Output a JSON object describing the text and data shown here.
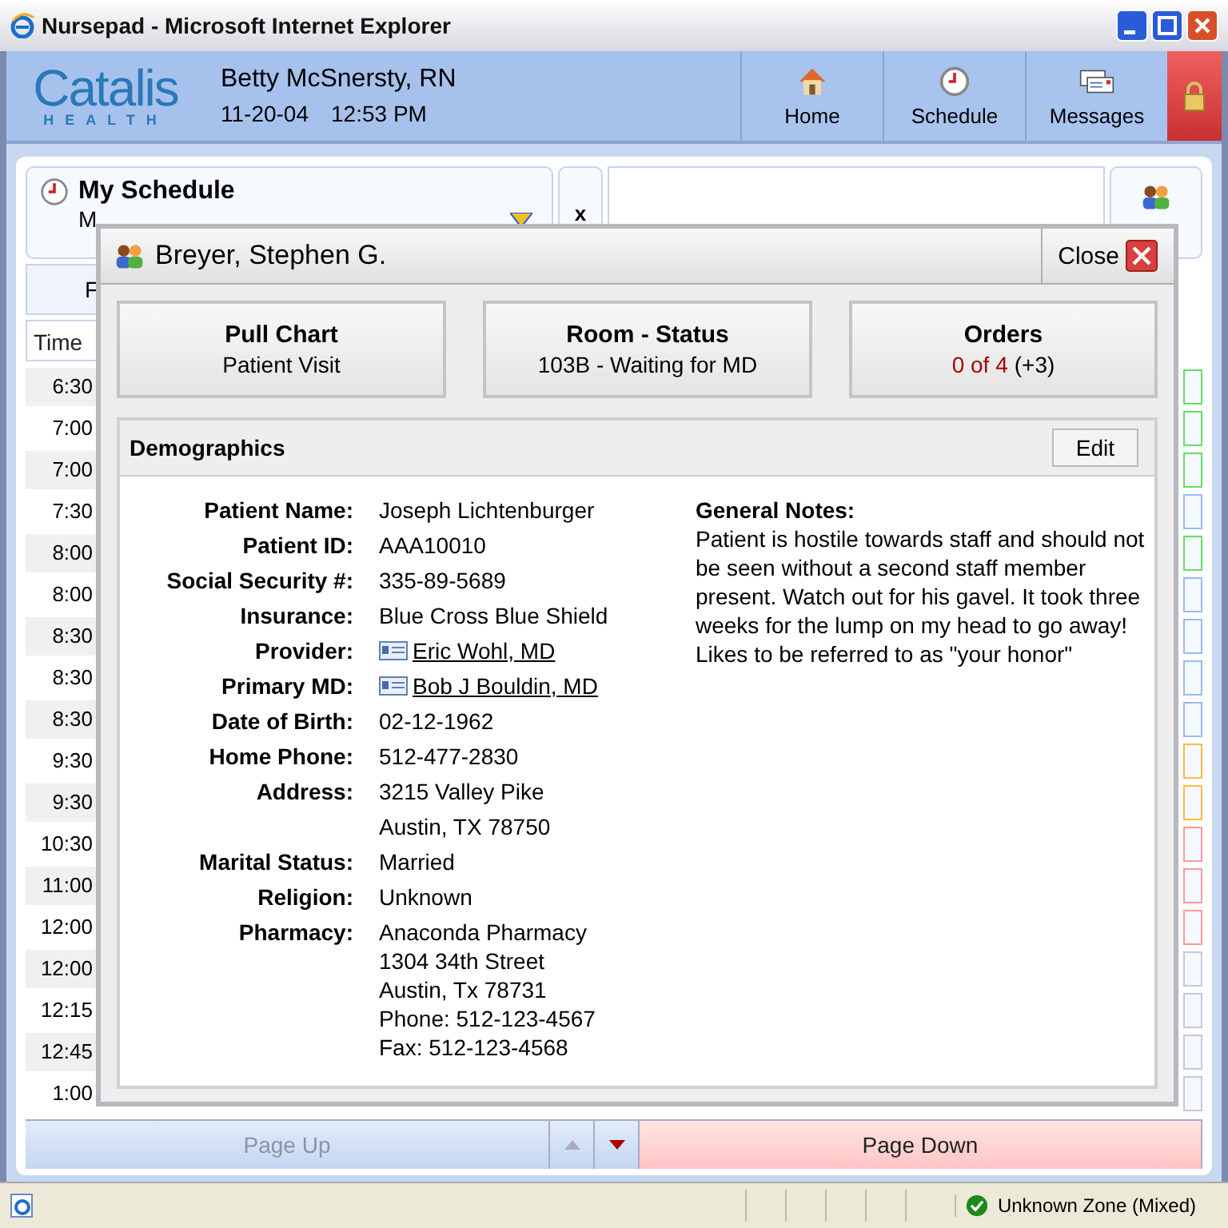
{
  "window": {
    "title": "Nursepad - Microsoft Internet Explorer"
  },
  "header": {
    "logo": "Catalis",
    "logo_sub": "HEALTH",
    "user": "Betty McSnersty, RN",
    "date": "11-20-04",
    "time": "12:53 PM",
    "nav": [
      {
        "label": "Home",
        "kind": "home"
      },
      {
        "label": "Schedule",
        "kind": "schedule"
      },
      {
        "label": "Messages",
        "kind": "messages"
      }
    ]
  },
  "schedule": {
    "title": "My Schedule",
    "subtitle": "M",
    "clear": "x",
    "tab": "F",
    "time_heading": "Time",
    "rows": [
      {
        "time": "6:30",
        "color": "#66dd66"
      },
      {
        "time": "7:00",
        "color": "#66dd66"
      },
      {
        "time": "7:00",
        "color": "#66dd66"
      },
      {
        "time": "7:30",
        "color": "#99bbee"
      },
      {
        "time": "8:00",
        "color": "#66dd66"
      },
      {
        "time": "8:00",
        "color": "#99bbee"
      },
      {
        "time": "8:30",
        "color": "#99bbee"
      },
      {
        "time": "8:30",
        "color": "#99bbee"
      },
      {
        "time": "8:30",
        "color": "#99bbee"
      },
      {
        "time": "9:30",
        "color": "#ffbb44"
      },
      {
        "time": "9:30",
        "color": "#ffbb44"
      },
      {
        "time": "10:30",
        "color": "#ff9999"
      },
      {
        "time": "11:00",
        "color": "#ff9999"
      },
      {
        "time": "12:00",
        "color": "#ff9999"
      },
      {
        "time": "12:00",
        "color": "#c8c8d8"
      },
      {
        "time": "12:15",
        "color": "#c8c8d8"
      },
      {
        "time": "12:45",
        "color": "#c8c8d8"
      },
      {
        "time": "1:00",
        "color": "#c8c8d8"
      }
    ],
    "page_up": {
      "label": "Page Up",
      "disabled": true
    },
    "page_down": {
      "label": "Page Down",
      "disabled": false
    }
  },
  "patient_dialog": {
    "title": "Breyer, Stephen G.",
    "close": "Close",
    "actions": [
      {
        "title": "Pull Chart",
        "detail": "Patient Visit"
      },
      {
        "title": "Room - Status",
        "detail": "103B - Waiting for MD"
      },
      {
        "title": "Orders",
        "detail": "0 of 4",
        "extra": "(+3)"
      }
    ],
    "demographics": {
      "title": "Demographics",
      "edit": "Edit",
      "fields": [
        {
          "label": "Patient Name:",
          "lines": [
            "Joseph Lichtenburger"
          ]
        },
        {
          "label": "Patient ID:",
          "lines": [
            "AAA10010"
          ]
        },
        {
          "label": "Social Security #:",
          "lines": [
            "335-89-5689"
          ]
        },
        {
          "label": "Insurance:",
          "lines": [
            "Blue Cross Blue Shield"
          ]
        },
        {
          "label": "Provider:",
          "kind": "contact",
          "lines": [
            "Eric Wohl, MD"
          ]
        },
        {
          "label": "Primary MD:",
          "kind": "contact",
          "lines": [
            "Bob J Bouldin, MD"
          ]
        },
        {
          "label": "Date of Birth:",
          "lines": [
            "02-12-1962"
          ]
        },
        {
          "label": "Home Phone:",
          "lines": [
            "512-477-2830"
          ]
        },
        {
          "label": "Address:",
          "lines": [
            "3215 Valley Pike",
            "Austin, TX  78750"
          ]
        },
        {
          "label": "Marital Status:",
          "lines": [
            "Married"
          ]
        },
        {
          "label": "Religion:",
          "lines": [
            "Unknown"
          ]
        },
        {
          "label": "Pharmacy:",
          "kind": "compact",
          "lines": [
            "Anaconda Pharmacy",
            "1304 34th Street",
            "Austin, Tx 78731",
            "Phone: 512-123-4567",
            "Fax: 512-123-4568"
          ]
        }
      ],
      "notes_title": "General Notes:",
      "notes": [
        "Patient is hostile towards staff and should not be seen without a second staff member present.  Watch out for his gavel. It took three weeks for the lump on my head to go away!",
        "Likes to be referred to as \"your honor\""
      ]
    }
  },
  "status_bar": {
    "zone": "Unknown Zone (Mixed)"
  }
}
